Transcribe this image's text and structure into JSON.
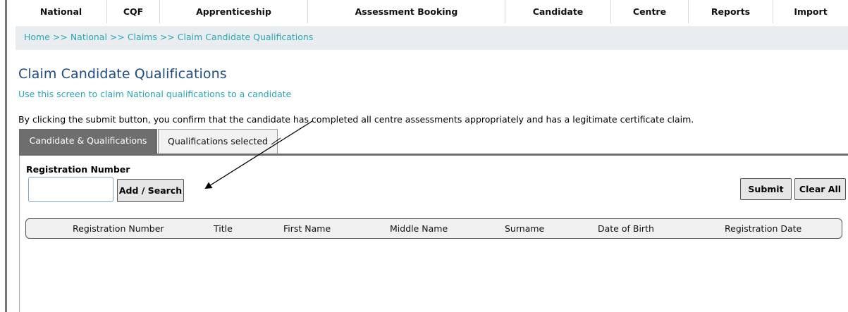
{
  "nav": {
    "items": [
      {
        "label": "National"
      },
      {
        "label": "CQF"
      },
      {
        "label": "Apprenticeship"
      },
      {
        "label": "Assessment Booking"
      },
      {
        "label": "Candidate"
      },
      {
        "label": "Centre"
      },
      {
        "label": "Reports"
      },
      {
        "label": "Import"
      }
    ]
  },
  "breadcrumb": {
    "home": "Home",
    "national": "National",
    "claims": "Claims",
    "current": "Claim Candidate Qualifications",
    "separator": " >> "
  },
  "page": {
    "title": "Claim Candidate Qualifications",
    "subtitle": "Use this screen to claim National qualifications to a candidate",
    "notice": "By clicking the submit button, you confirm that the candidate has completed all centre assessments appropriately and has a legitimate certificate claim."
  },
  "tabs": [
    {
      "label": "Candidate & Qualifications",
      "active": true
    },
    {
      "label": "Qualifications selected",
      "active": false
    }
  ],
  "form": {
    "registration_label": "Registration Number",
    "registration_value": "",
    "add_search_label": "Add / Search",
    "submit_label": "Submit",
    "clear_all_label": "Clear All"
  },
  "table": {
    "columns": [
      "Registration Number",
      "Title",
      "First Name",
      "Middle Name",
      "Surname",
      "Date of Birth",
      "Registration Date"
    ],
    "rows": []
  },
  "colors": {
    "title": "#1f4d87",
    "link": "#2aa6b3",
    "active_tab": "#6e6e6e",
    "breadcrumb_bg": "#e9edef"
  }
}
